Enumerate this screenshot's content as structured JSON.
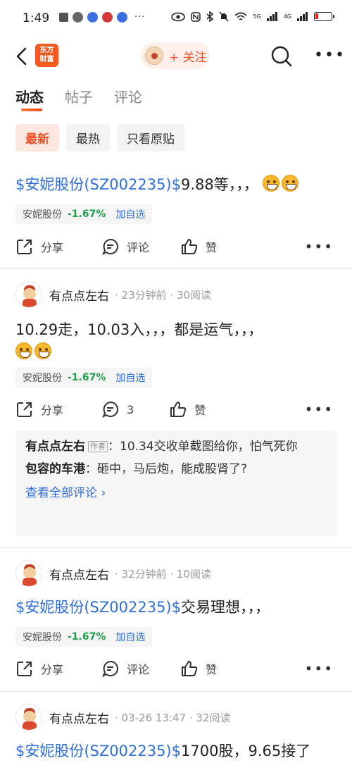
{
  "status": {
    "time": "1:49",
    "more": "···",
    "signal1": "5G",
    "signal2": "4G",
    "battery_fraction": 0.18
  },
  "nav": {
    "logo_line1": "东方",
    "logo_line2": "财富",
    "follow_label": "+ 关注"
  },
  "tabs": [
    {
      "label": "动态",
      "active": true
    },
    {
      "label": "帖子",
      "active": false
    },
    {
      "label": "评论",
      "active": false
    }
  ],
  "filters": [
    {
      "label": "最新",
      "active": true
    },
    {
      "label": "最热",
      "active": false
    },
    {
      "label": "只看原贴",
      "active": false
    }
  ],
  "posts": [
    {
      "stock_link": "$安妮股份(SZ002235)$",
      "text": "9.88等，，，",
      "stock_name": "安妮股份",
      "stock_change": "-1.67%",
      "add_watch": "加自选",
      "share": "分享",
      "comment": "评论",
      "like": "赞"
    },
    {
      "author": "有点点左右",
      "meta": "· 23分钟前 · 30阅读",
      "text": "10.29走，10.03入，，，都是运气，，，",
      "stock_name": "安妮股份",
      "stock_change": "-1.67%",
      "add_watch": "加自选",
      "share": "分享",
      "comment": "3",
      "like": "赞",
      "comments": [
        {
          "author": "有点点左右",
          "badge": "作者",
          "sep": "：",
          "text": "10.34交收单截图给你，怕气死你"
        },
        {
          "author": "包容的车港",
          "sep": "：",
          "text": "砸中，马后炮，能成股肾了?"
        }
      ],
      "view_all": "查看全部评论 ›"
    },
    {
      "author": "有点点左右",
      "meta": "· 32分钟前 · 10阅读",
      "stock_link": "$安妮股份(SZ002235)$",
      "text": "交易理想，，，",
      "stock_name": "安妮股份",
      "stock_change": "-1.67%",
      "add_watch": "加自选",
      "share": "分享",
      "comment": "评论",
      "like": "赞"
    },
    {
      "author": "有点点左右",
      "meta": "· 03-26 13:47 · 32阅读",
      "stock_link": "$安妮股份(SZ002235)$",
      "text": "1700股，9.65接了"
    }
  ],
  "colors": {
    "accent": "#f04e23",
    "link": "#2f6fd6",
    "down_green": "#1e9e4a"
  }
}
